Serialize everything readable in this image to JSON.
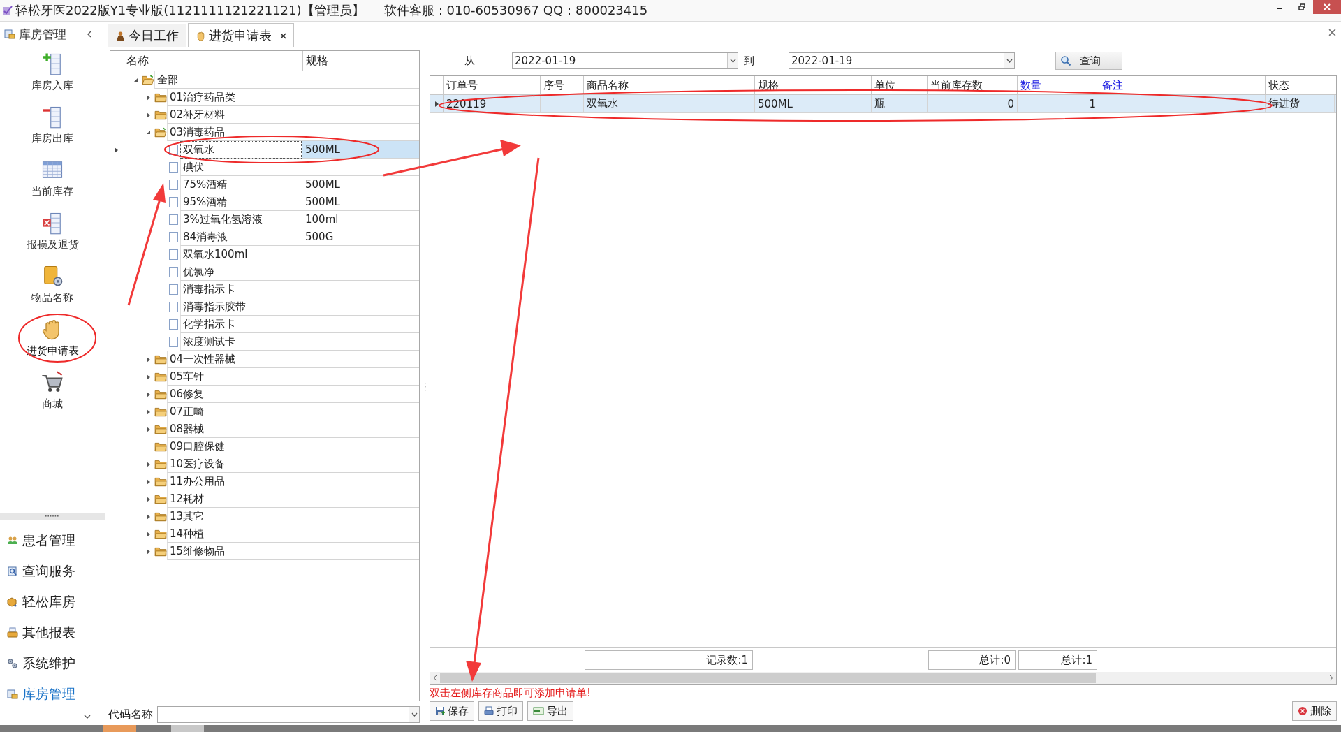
{
  "title_bar": {
    "title": "轻松牙医2022版Y1专业版(1121111121221121)【管理员】",
    "support": "软件客服：010-60530967 QQ：800023415"
  },
  "sidebar": {
    "header": "库房管理",
    "tools": [
      {
        "label": "库房入库",
        "kind": "stock-in",
        "selected": false
      },
      {
        "label": "库房出库",
        "kind": "stock-out",
        "selected": false
      },
      {
        "label": "当前库存",
        "kind": "inventory",
        "selected": false
      },
      {
        "label": "报损及退货",
        "kind": "loss",
        "selected": false
      },
      {
        "label": "物品名称",
        "kind": "items",
        "selected": false
      },
      {
        "label": "进货申请表",
        "kind": "request",
        "selected": true
      },
      {
        "label": "商城",
        "kind": "mall",
        "selected": false
      }
    ],
    "nav": [
      {
        "label": "患者管理",
        "kind": "patients",
        "selected": false
      },
      {
        "label": "查询服务",
        "kind": "query",
        "selected": false
      },
      {
        "label": "轻松库房",
        "kind": "store",
        "selected": false
      },
      {
        "label": "其他报表",
        "kind": "reports",
        "selected": false
      },
      {
        "label": "系统维护",
        "kind": "system",
        "selected": false
      },
      {
        "label": "库房管理",
        "kind": "warehouse",
        "selected": true
      }
    ]
  },
  "tabs": [
    {
      "label": "今日工作",
      "kind": "work",
      "selected": false,
      "closable": false
    },
    {
      "label": "进货申请表",
      "kind": "request",
      "selected": true,
      "closable": true
    }
  ],
  "tree": {
    "columns": [
      "名称",
      "规格"
    ],
    "nodes": [
      {
        "kind": "folder",
        "name": "全部",
        "expandable": true,
        "expanded": true,
        "children": [
          {
            "kind": "folder",
            "name": "01治疗药品类",
            "expandable": true,
            "expanded": false
          },
          {
            "kind": "folder",
            "name": "02补牙材料",
            "expandable": true,
            "expanded": false
          },
          {
            "kind": "folder",
            "name": "03消毒药品",
            "expandable": true,
            "expanded": true,
            "children": [
              {
                "kind": "item",
                "name": "双氧水",
                "spec": "500ML",
                "checked": false,
                "selected": true
              },
              {
                "kind": "item",
                "name": "碘伏",
                "checked": false,
                "selected": false
              },
              {
                "kind": "item",
                "name": "75%酒精",
                "spec": "500ML",
                "checked": false,
                "selected": false
              },
              {
                "kind": "item",
                "name": "95%酒精",
                "spec": "500ML",
                "checked": false,
                "selected": false
              },
              {
                "kind": "item",
                "name": "3%过氧化氢溶液",
                "spec": "100ml",
                "checked": false,
                "selected": false
              },
              {
                "kind": "item",
                "name": "84消毒液",
                "spec": "500G",
                "checked": false,
                "selected": false
              },
              {
                "kind": "item",
                "name": "双氧水100ml",
                "checked": false,
                "selected": false
              },
              {
                "kind": "item",
                "name": "优氯净",
                "checked": false,
                "selected": false
              },
              {
                "kind": "item",
                "name": "消毒指示卡",
                "checked": false,
                "selected": false
              },
              {
                "kind": "item",
                "name": "消毒指示胶带",
                "checked": false,
                "selected": false
              },
              {
                "kind": "item",
                "name": "化学指示卡",
                "checked": false,
                "selected": false
              },
              {
                "kind": "item",
                "name": "浓度测试卡",
                "checked": false,
                "selected": false
              }
            ]
          },
          {
            "kind": "folder",
            "name": "04一次性器械",
            "expandable": true,
            "expanded": false
          },
          {
            "kind": "folder",
            "name": "05车针",
            "expandable": true,
            "expanded": false
          },
          {
            "kind": "folder",
            "name": "06修复",
            "expandable": true,
            "expanded": false
          },
          {
            "kind": "folder",
            "name": "07正畸",
            "expandable": true,
            "expanded": false
          },
          {
            "kind": "folder",
            "name": "08器械",
            "expandable": true,
            "expanded": false
          },
          {
            "kind": "folder",
            "name": "09口腔保健",
            "expandable": false,
            "expanded": false
          },
          {
            "kind": "folder",
            "name": "10医疗设备",
            "expandable": true,
            "expanded": false
          },
          {
            "kind": "folder",
            "name": "11办公用品",
            "expandable": true,
            "expanded": false
          },
          {
            "kind": "folder",
            "name": "12耗材",
            "expandable": true,
            "expanded": false
          },
          {
            "kind": "folder",
            "name": "13其它",
            "expandable": true,
            "expanded": false
          },
          {
            "kind": "folder",
            "name": "14种植",
            "expandable": true,
            "expanded": false
          },
          {
            "kind": "folder",
            "name": "15维修物品",
            "expandable": true,
            "expanded": false
          }
        ]
      }
    ]
  },
  "code_search": {
    "label": "代码名称"
  },
  "filter": {
    "from_label": "从",
    "from": "2022-01-19",
    "to_label": "到",
    "to": "2022-01-19",
    "button": "查询"
  },
  "grid": {
    "columns": [
      {
        "label": "订单号",
        "kind": "text",
        "editable": false
      },
      {
        "label": "序号",
        "kind": "text",
        "editable": false
      },
      {
        "label": "商品名称",
        "kind": "text",
        "editable": false
      },
      {
        "label": "规格",
        "kind": "text",
        "editable": false
      },
      {
        "label": "单位",
        "kind": "text",
        "editable": false
      },
      {
        "label": "当前库存数",
        "kind": "number",
        "editable": false
      },
      {
        "label": "数量",
        "kind": "number",
        "editable": true
      },
      {
        "label": "备注",
        "kind": "text",
        "editable": true
      },
      {
        "label": "状态",
        "kind": "text",
        "editable": false
      }
    ],
    "rows": [
      {
        "cells": [
          "220119",
          null,
          "双氧水",
          "500ML",
          "瓶",
          "0",
          "1",
          null,
          "待进货"
        ],
        "selected": true
      }
    ],
    "footer": [
      {
        "text": "记录数:1",
        "kind": "record_count"
      },
      {
        "text": "总计:0",
        "kind": "stock_total"
      },
      {
        "text": "总计:1",
        "kind": "quantity_total"
      }
    ]
  },
  "hint": "双击左侧库存商品即可添加申请单!",
  "actions": [
    {
      "label": "保存",
      "kind": "save"
    },
    {
      "label": "打印",
      "kind": "print"
    },
    {
      "label": "导出",
      "kind": "export"
    }
  ],
  "delete_button": "删除"
}
